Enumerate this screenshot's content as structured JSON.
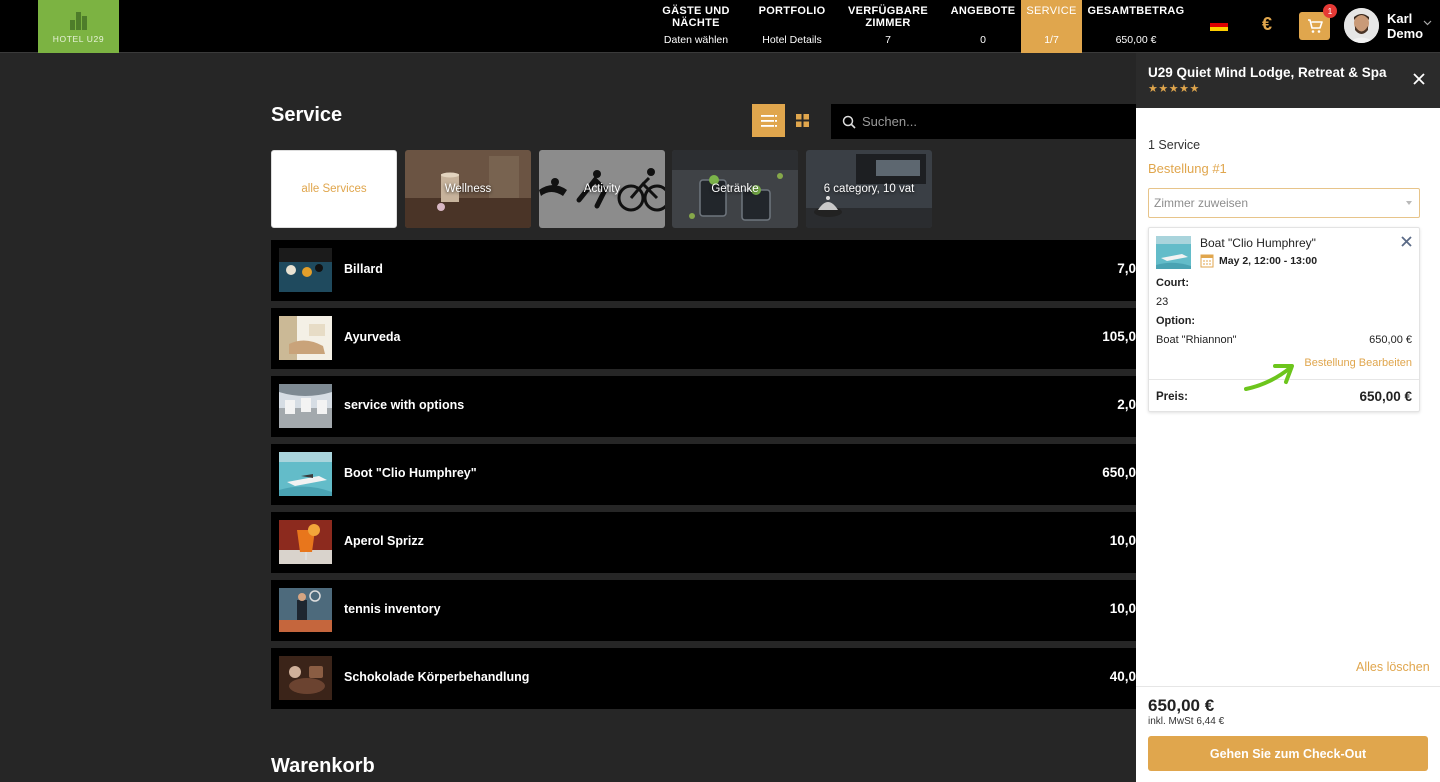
{
  "brand": {
    "logo_text": "HOTEL U29"
  },
  "steps": [
    {
      "title": "GÄSTE UND\nNÄCHTE",
      "sub": "Daten wählen"
    },
    {
      "title": "PORTFOLIO",
      "sub": "Hotel Details"
    },
    {
      "title": "VERFÜGBARE\nZIMMER",
      "sub": "7"
    },
    {
      "title": "ANGEBOTE",
      "sub": "0"
    },
    {
      "title": "SERVICE",
      "sub": "1/7"
    },
    {
      "title": "GESAMTBETRAG",
      "sub": "650,00 €"
    }
  ],
  "header": {
    "language_icon": "flag-de-icon",
    "currency_symbol": "€",
    "cart_count": "1",
    "user_name": "Karl\nDemo"
  },
  "main": {
    "title": "Service",
    "search_placeholder": "Suchen...",
    "categories": [
      {
        "label": "alle Services"
      },
      {
        "label": "Wellness"
      },
      {
        "label": "Activity"
      },
      {
        "label": "Getränke"
      },
      {
        "label": "6 category, 10 vat"
      }
    ],
    "services": [
      {
        "name": "Billard",
        "price": "7,0"
      },
      {
        "name": "Ayurveda",
        "price": "105,0"
      },
      {
        "name": "service with options",
        "price": "2,0"
      },
      {
        "name": "Boot \"Clio Humphrey\"",
        "price": "650,0"
      },
      {
        "name": "Aperol Sprizz",
        "price": "10,0"
      },
      {
        "name": "tennis inventory",
        "price": "10,0"
      },
      {
        "name": "Schokolade Körperbehandlung",
        "price": "40,0"
      }
    ],
    "cart_title": "Warenkorb"
  },
  "panel": {
    "hotel_name": "U29 Quiet Mind Lodge, Retreat & Spa",
    "stars": "★★★★★",
    "service_count": "1 Service",
    "order_label": "Bestellung #1",
    "room_placeholder": "Zimmer zuweisen",
    "item": {
      "title": "Boat \"Clio Humphrey\"",
      "date": "May 2, 12:00 - 13:00",
      "court_label": "Court:",
      "court_value": "23",
      "option_label": "Option:",
      "option_value": "Boat \"Rhiannon\"",
      "option_price": "650,00 €",
      "edit_label": "Bestellung Bearbeiten",
      "price_label": "Preis:",
      "price_value": "650,00 €"
    },
    "clear_label": "Alles löschen",
    "total": "650,00 €",
    "tax": "inkl. MwSt 6,44 €",
    "checkout_label": "Gehen Sie zum Check-Out"
  },
  "colors": {
    "accent": "#e0a64d",
    "brand_green": "#7cb342",
    "arrow_green": "#6cc51c"
  }
}
